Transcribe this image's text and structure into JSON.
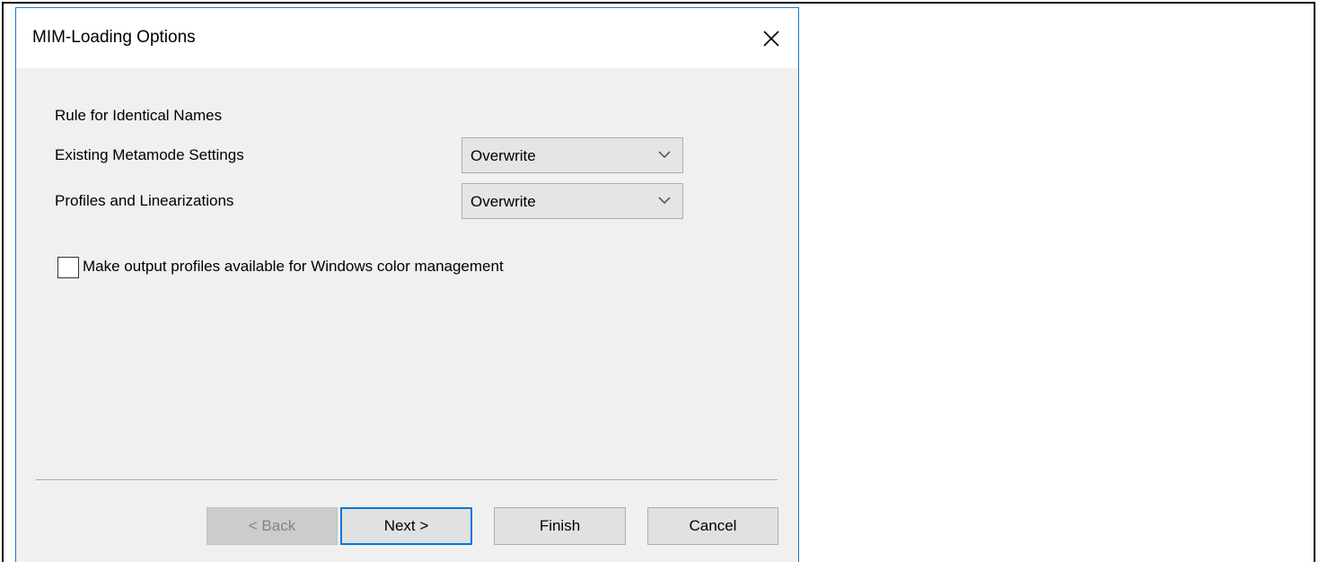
{
  "dialog": {
    "title": "MIM-Loading Options",
    "close_icon": "close-icon"
  },
  "section": {
    "heading": "Rule for Identical Names"
  },
  "rules": [
    {
      "label": "Existing Metamode Settings",
      "value": "Overwrite"
    },
    {
      "label": "Profiles and Linearizations",
      "value": "Overwrite"
    }
  ],
  "checkbox": {
    "label": "Make output profiles available for Windows color management",
    "checked": false
  },
  "buttons": {
    "back": "< Back",
    "next": "Next >",
    "finish": "Finish",
    "cancel": "Cancel"
  },
  "colors": {
    "accent": "#0078d7",
    "dialog_border": "#1979ca",
    "dialog_background": "#f0f0f0"
  }
}
